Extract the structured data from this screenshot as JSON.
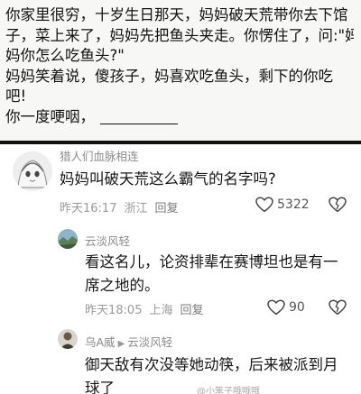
{
  "story": {
    "lines": [
      "你家里很穷，十岁生日那天，妈妈破天荒带你去下馆",
      "子，菜上来了，妈妈先把鱼头夹走。你愣住了，问:\"妈",
      "妈你怎么吃鱼头?\"",
      "妈妈笑着说，傻孩子，妈喜欢吃鱼头，剩下的你吃",
      "吧!",
      "你一度哽咽，"
    ]
  },
  "comments": [
    {
      "user": "猎人们血脉相连",
      "text": "妈妈叫破天荒这么霸气的名字吗?",
      "time": "昨天16:17",
      "location": "浙江",
      "reply_label": "回复",
      "likes": "5322"
    },
    {
      "user": "云淡风轻",
      "text_lines": [
        "看这名儿，论资排辈在赛博坦也是有一",
        "席之地的。"
      ],
      "time": "昨天18:05",
      "location": "上海",
      "reply_label": "回复",
      "likes": "90"
    },
    {
      "user": "乌A威",
      "reply_to": "云淡风轻",
      "text_lines": [
        "御天敌有次没等她动筷，后来被派到月",
        "球了"
      ]
    }
  ],
  "watermark": "@小笨子哦哦哦",
  "icons": {
    "heart": "heart-icon",
    "dislike": "broken-heart-icon",
    "reply_arrow": "triangle-right-icon"
  }
}
